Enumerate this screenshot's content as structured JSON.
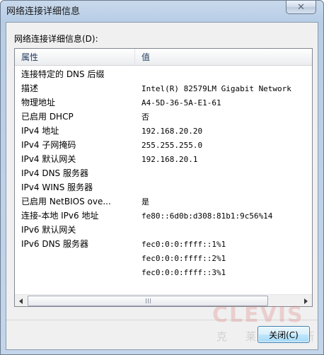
{
  "window": {
    "title": "网络连接详细信息",
    "close_label": "✕"
  },
  "group_label": "网络连接详细信息(D):",
  "table": {
    "headers": {
      "property": "属性",
      "value": "值"
    },
    "rows": [
      {
        "property": "连接特定的 DNS 后缀",
        "value": ""
      },
      {
        "property": "描述",
        "value": "Intel(R) 82579LM Gigabit Network"
      },
      {
        "property": "物理地址",
        "value": "A4-5D-36-5A-E1-61"
      },
      {
        "property": "已启用 DHCP",
        "value": "否"
      },
      {
        "property": "IPv4 地址",
        "value": "192.168.20.20"
      },
      {
        "property": "IPv4 子网掩码",
        "value": "255.255.255.0"
      },
      {
        "property": "IPv4 默认网关",
        "value": "192.168.20.1"
      },
      {
        "property": "IPv4 DNS 服务器",
        "value": ""
      },
      {
        "property": "IPv4 WINS 服务器",
        "value": ""
      },
      {
        "property": "已启用 NetBIOS ove...",
        "value": "是"
      },
      {
        "property": "连接-本地 IPv6 地址",
        "value": "fe80::6d0b:d308:81b1:9c56%14"
      },
      {
        "property": "IPv6 默认网关",
        "value": ""
      },
      {
        "property": "IPv6 DNS 服务器",
        "value": "fec0:0:0:ffff::1%1"
      },
      {
        "property": "",
        "value": "fec0:0:0:ffff::2%1"
      },
      {
        "property": "",
        "value": "fec0:0:0:ffff::3%1"
      }
    ]
  },
  "watermark": {
    "big": "CLEVIS",
    "small": "克莱维斯"
  },
  "close_button_label": "关闭(C)"
}
